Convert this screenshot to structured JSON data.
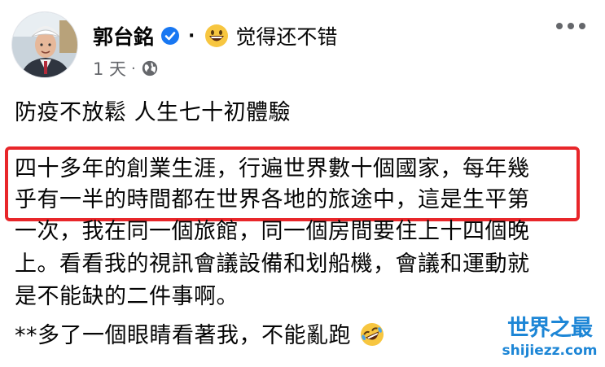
{
  "post": {
    "author": "郭台銘",
    "separator": "·",
    "feeling": "觉得还不错",
    "time": "1 天",
    "meta_separator": "·",
    "title_line": "防疫不放鬆 人生七十初體驗",
    "lines": [
      "四十多年的創業生涯，行遍世界數十個國家，每年幾",
      "乎有一半的時間都在世界各地的旅途中，這是生平第",
      "一次，我在同一個旅館，同一個房間要住上十四個晚",
      "上。看看我的視訊會議設備和划船機，會議和運動就",
      "是不能缺的二件事啊。"
    ],
    "footer_line": "**多了一個眼睛看著我，不能亂跑"
  },
  "icons": {
    "verified": "verified-badge-icon",
    "feeling": "grinning-face-emoji-icon",
    "audience": "globe-icon",
    "more": "more-options-icon",
    "laughing": "rolling-laughing-emoji-icon"
  },
  "colors": {
    "highlight_border": "#e8262a",
    "verified_blue": "#1877f2",
    "meta_gray": "#65676b",
    "watermark_blue": "#1d86d6"
  },
  "watermark": {
    "title": "世界之最",
    "url": "shijiezz.com"
  }
}
